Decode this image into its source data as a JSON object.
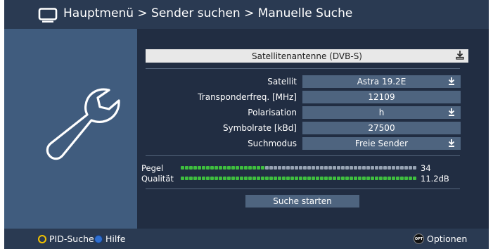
{
  "header": {
    "title": "Hauptmenü > Sender suchen > Manuelle Suche",
    "icon": "tv-icon"
  },
  "sidebar": {
    "icon": "wrench-icon"
  },
  "antenna_select": {
    "value": "Satellitenantenne (DVB-S)"
  },
  "rows": [
    {
      "label": "Satellit",
      "value": "Astra 19.2E",
      "dropdown": true
    },
    {
      "label": "Transponderfreq. [MHz]",
      "value": "12109",
      "dropdown": false
    },
    {
      "label": "Polarisation",
      "value": "h",
      "dropdown": true
    },
    {
      "label": "Symbolrate [kBd]",
      "value": "27500",
      "dropdown": false
    },
    {
      "label": "Suchmodus",
      "value": "Freie Sender",
      "dropdown": true
    }
  ],
  "meters": {
    "pegel": {
      "label": "Pegel",
      "value": "34",
      "fraction": 0.34
    },
    "qualitaet": {
      "label": "Qualität",
      "value": "11.2dB",
      "fraction": 1.0
    }
  },
  "start_button": {
    "label": "Suche starten"
  },
  "footer": {
    "pid_label": "PID-Suche",
    "help_label": "Hilfe",
    "options_label": "Optionen",
    "opt_badge": "OPT"
  },
  "colors": {
    "bar_bg": "#2a3a52",
    "left_panel": "#405c7e",
    "main_panel": "#212d42",
    "field": "#4e647f",
    "meter_on": "#3fbf3f",
    "meter_off": "#97a3b3",
    "yellow_key": "#f2c200",
    "blue_key": "#2f6fd0"
  }
}
